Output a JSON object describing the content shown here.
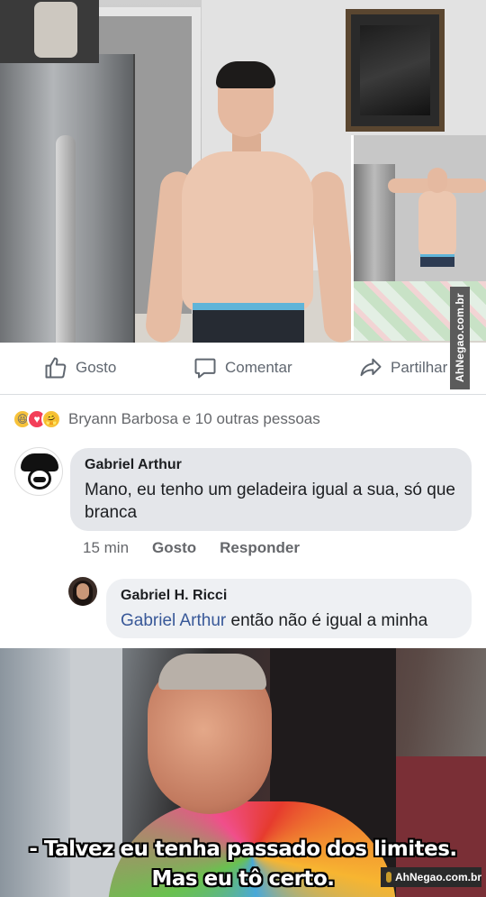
{
  "post": {
    "watermark_vertical": "AhNegao.com.br",
    "actions": {
      "like_label": "Gosto",
      "comment_label": "Comentar",
      "share_label": "Partilhar"
    },
    "reactions": {
      "icons": [
        "haha",
        "love",
        "care"
      ],
      "summary": "Bryann Barbosa e 10 outras pessoas"
    }
  },
  "comments": [
    {
      "author": "Gabriel Arthur",
      "text": "Mano, eu tenho um geladeira igual a sua, só que branca",
      "time": "15 min",
      "like_label": "Gosto",
      "reply_label": "Responder"
    },
    {
      "author": "Gabriel H. Ricci",
      "mention": "Gabriel Arthur",
      "text": " então não é igual a minha"
    }
  ],
  "meme": {
    "line1": "- Talvez eu tenha passado dos limites.",
    "line2": "Mas eu tô certo.",
    "watermark": "AhNegao.com.br"
  },
  "colors": {
    "mention": "#385898",
    "bubble": "#e4e6ea",
    "action_text": "#606770"
  }
}
